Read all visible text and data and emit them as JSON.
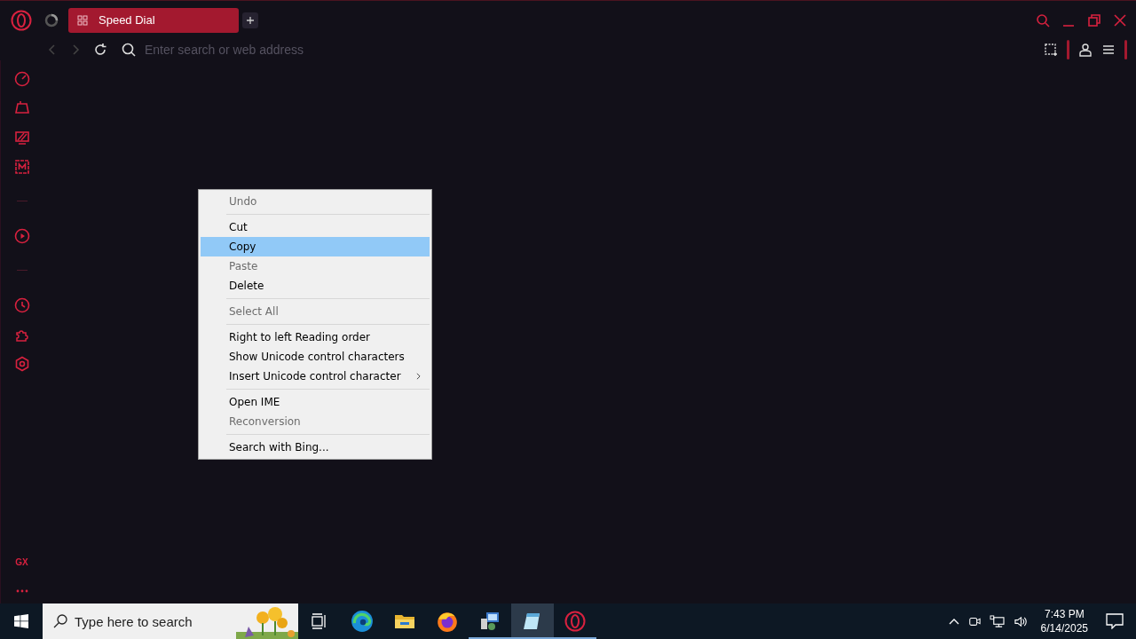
{
  "tabs": [
    {
      "label": "Speed Dial",
      "selected": true
    }
  ],
  "address_bar": {
    "placeholder": "Enter search or web address"
  },
  "sidebar": {
    "badge": "GX"
  },
  "context_menu": {
    "items": [
      {
        "kind": "item",
        "label": "Undo",
        "disabled": true,
        "selected": false,
        "submenu": false
      },
      {
        "kind": "separator"
      },
      {
        "kind": "item",
        "label": "Cut",
        "disabled": false,
        "selected": false,
        "submenu": false
      },
      {
        "kind": "item",
        "label": "Copy",
        "disabled": false,
        "selected": true,
        "submenu": false
      },
      {
        "kind": "item",
        "label": "Paste",
        "disabled": true,
        "selected": false,
        "submenu": false
      },
      {
        "kind": "item",
        "label": "Delete",
        "disabled": false,
        "selected": false,
        "submenu": false
      },
      {
        "kind": "separator"
      },
      {
        "kind": "item",
        "label": "Select All",
        "disabled": true,
        "selected": false,
        "submenu": false
      },
      {
        "kind": "separator"
      },
      {
        "kind": "item",
        "label": "Right to left Reading order",
        "disabled": false,
        "selected": false,
        "submenu": false
      },
      {
        "kind": "item",
        "label": "Show Unicode control characters",
        "disabled": false,
        "selected": false,
        "submenu": false
      },
      {
        "kind": "item",
        "label": "Insert Unicode control character",
        "disabled": false,
        "selected": false,
        "submenu": true
      },
      {
        "kind": "separator"
      },
      {
        "kind": "item",
        "label": "Open IME",
        "disabled": false,
        "selected": false,
        "submenu": false
      },
      {
        "kind": "item",
        "label": "Reconversion",
        "disabled": true,
        "selected": false,
        "submenu": false
      },
      {
        "kind": "separator"
      },
      {
        "kind": "item",
        "label": "Search with Bing...",
        "disabled": false,
        "selected": false,
        "submenu": false
      }
    ]
  },
  "taskbar": {
    "search": {
      "placeholder": "Type here to search"
    },
    "apps": [
      {
        "kind": "task_view",
        "running": false,
        "active": false
      },
      {
        "kind": "edge",
        "running": false,
        "active": false
      },
      {
        "kind": "explorer",
        "running": false,
        "active": false
      },
      {
        "kind": "firefox",
        "running": false,
        "active": false
      },
      {
        "kind": "installer",
        "running": true,
        "active": false
      },
      {
        "kind": "notepad",
        "running": true,
        "active": true
      },
      {
        "kind": "opera",
        "running": true,
        "active": false
      }
    ],
    "time": "7:43 PM",
    "date": "6/14/2025"
  }
}
